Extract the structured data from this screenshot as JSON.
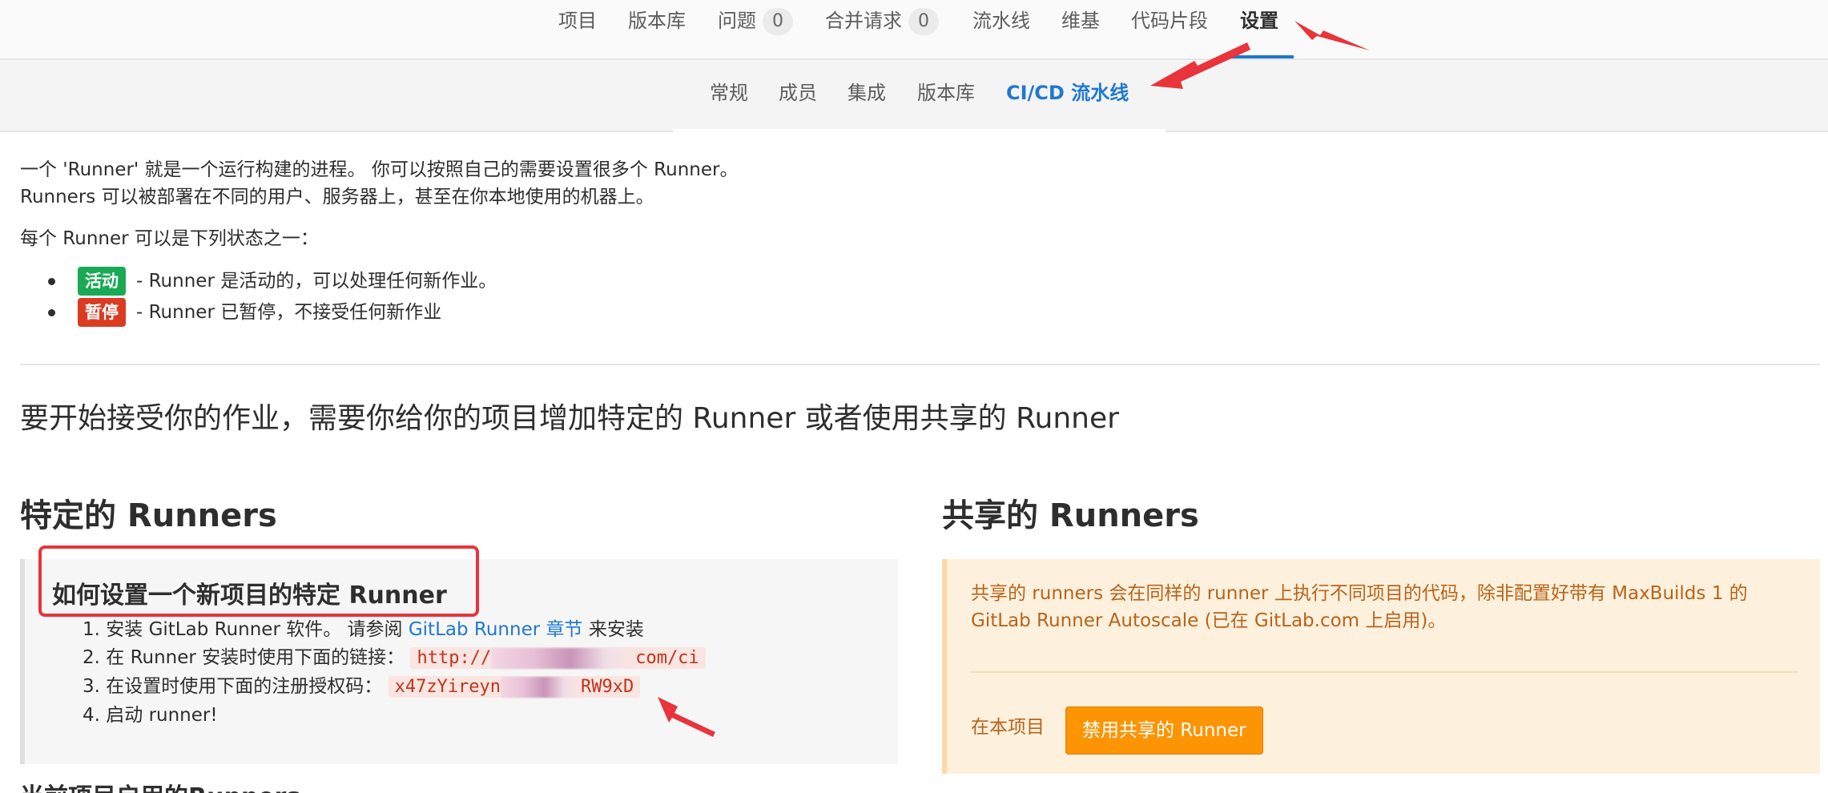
{
  "top_nav": {
    "items": [
      {
        "label": "项目"
      },
      {
        "label": "版本库"
      },
      {
        "label": "问题",
        "count": "0"
      },
      {
        "label": "合并请求",
        "count": "0"
      },
      {
        "label": "流水线"
      },
      {
        "label": "维基"
      },
      {
        "label": "代码片段"
      },
      {
        "label": "设置",
        "active": true
      }
    ]
  },
  "sub_nav": {
    "items": [
      {
        "label": "常规"
      },
      {
        "label": "成员"
      },
      {
        "label": "集成"
      },
      {
        "label": "版本库"
      },
      {
        "label": "CI/CD 流水线",
        "active": true
      }
    ]
  },
  "intro": {
    "line1": "一个 'Runner' 就是一个运行构建的进程。 你可以按照自己的需要设置很多个 Runner。",
    "line2": "Runners 可以被部署在不同的用户、服务器上，甚至在你本地使用的机器上。",
    "states_intro": "每个 Runner 可以是下列状态之一：",
    "states": [
      {
        "badge": "活动",
        "color": "#1aaa55",
        "desc": "- Runner 是活动的，可以处理任何新作业。"
      },
      {
        "badge": "暂停",
        "color": "#db3b21",
        "desc": "- Runner 已暂停，不接受任何新作业"
      }
    ]
  },
  "lead": "要开始接受你的作业，需要你给你的项目增加特定的 Runner 或者使用共享的 Runner",
  "specific": {
    "heading": "特定的 Runners",
    "box_title": "如何设置一个新项目的特定 Runner",
    "step1_prefix": "1. 安装 GitLab Runner 软件。 请参阅",
    "step1_link": "GitLab Runner 章节",
    "step1_suffix": "来安装",
    "step2_prefix": "2. 在 Runner 安装时使用下面的链接：",
    "step2_url_start": "http://",
    "step2_url_end": "com/ci",
    "step3_prefix": "3. 在设置时使用下面的注册授权码：",
    "step3_token_start": "x47zYireyn",
    "step3_token_end": "RW9xD",
    "step4": "4. 启动 runner!"
  },
  "shared": {
    "heading": "共享的 Runners",
    "text_line1": "共享的 runners 会在同样的 runner 上执行不同项目的代码，除非配置好带有 MaxBuilds 1 的",
    "text_line2": "GitLab Runner Autoscale (已在 GitLab.com 上启用)。",
    "project_label": "在本项目",
    "disable_button": "禁用共享的 Runner"
  },
  "next_heading": "当前项目启用的Runners",
  "colors": {
    "accent_blue": "#1f78d1",
    "active_green": "#1aaa55",
    "paused_red": "#db3b21",
    "warning_orange": "#fc9403",
    "annotation_red": "#e8343a"
  }
}
